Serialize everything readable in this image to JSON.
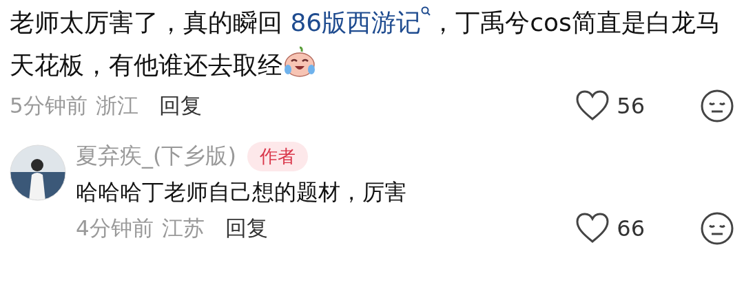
{
  "comments": [
    {
      "text_before": "老师太厉害了，真的瞬回 ",
      "link": "86版西游记",
      "text_after": "，丁禹兮cos简直是白龙马天花板，有他谁还去取经",
      "time": "5分钟前",
      "location": "浙江",
      "reply": "回复",
      "likes": "56"
    },
    {
      "author": "夏弃疾_(下乡版)",
      "badge": "作者",
      "text": "哈哈哈丁老师自己想的题材，厉害",
      "time": "4分钟前",
      "location": "江苏",
      "reply": "回复",
      "likes": "66"
    }
  ]
}
